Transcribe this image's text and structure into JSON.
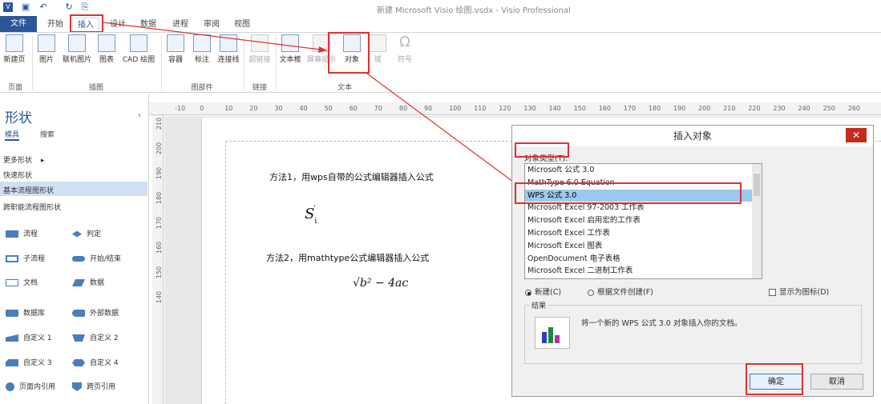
{
  "window": {
    "title": "新建 Microsoft Visio 绘图.vsdx - Visio Professional"
  },
  "tabs": [
    "文件",
    "开始",
    "插入",
    "设计",
    "数据",
    "进程",
    "审阅",
    "视图"
  ],
  "ribbon": {
    "buttons": [
      "新建页",
      "图片",
      "联机图片",
      "图表",
      "CAD 绘图",
      "容器",
      "标注",
      "连接线",
      "超链接",
      "文本框",
      "屏幕提示",
      "对象",
      "域",
      "符号"
    ],
    "groups": [
      "页面",
      "插图",
      "图部件",
      "链接",
      "文本"
    ]
  },
  "shapes": {
    "title": "形状",
    "tab_stencil": "模具",
    "tab_search": "搜索",
    "more": "更多形状",
    "quick": "快速形状",
    "basic": "基本流程图形状",
    "cross": "跨职能流程图形状",
    "items": [
      "流程",
      "判定",
      "子流程",
      "开始/结束",
      "文档",
      "数据",
      "数据库",
      "外部数据",
      "自定义 1",
      "自定义 2",
      "自定义 3",
      "自定义 4",
      "页面内引用",
      "跨页引用"
    ]
  },
  "ruler": {
    "top": [
      "-10",
      "0",
      "10",
      "20",
      "30",
      "40",
      "50",
      "60",
      "70",
      "80",
      "90",
      "100",
      "110",
      "120",
      "130",
      "140",
      "150",
      "160",
      "170",
      "180",
      "190",
      "200",
      "210",
      "220",
      "230",
      "240",
      "250",
      "260"
    ],
    "left": [
      "210",
      "200",
      "190",
      "180",
      "170",
      "160",
      "150",
      "140"
    ]
  },
  "document": {
    "method1": "方法1，用wps自带的公式编辑器插入公式",
    "formula1": "S",
    "formula1_sub": "i",
    "formula1_sup": "'",
    "method2": "方法2，用mathtype公式编辑器插入公式",
    "formula2": "√b² − 4ac"
  },
  "dialog": {
    "title": "插入对象",
    "close": "✕",
    "type_label": "对象类型(T):",
    "items": [
      "Microsoft 公式 3.0",
      "MathType 6.0 Equation",
      "WPS 公式 3.0",
      "Microsoft Excel 97-2003 工作表",
      "Microsoft Excel 启用宏的工作表",
      "Microsoft Excel 工作表",
      "Microsoft Excel 图表",
      "OpenDocument 电子表格",
      "Microsoft Excel 二进制工作表"
    ],
    "selected_index": 2,
    "radio_new": "新建(C)",
    "radio_file": "根据文件创建(F)",
    "show_icon": "显示为图标(D)",
    "result_label": "结果",
    "result_text": "将一个新的 WPS 公式 3.0 对象插入你的文档。",
    "ok": "确定",
    "cancel": "取消"
  },
  "colors": {
    "accent": "#2b579a",
    "annotation": "#e03030",
    "selection": "#99c9ef"
  }
}
